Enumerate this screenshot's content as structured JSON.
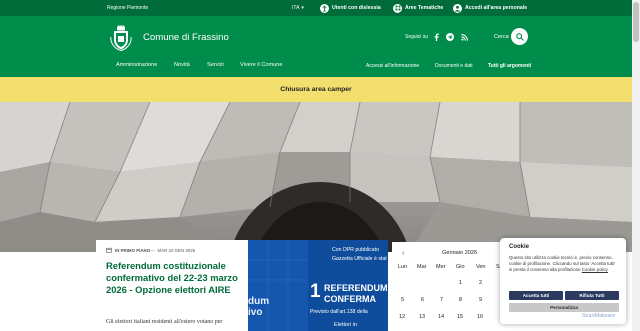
{
  "topbar": {
    "region": "Regione Piemonte",
    "lang": "ITA",
    "items": [
      {
        "label": "Utenti con dislessia",
        "icon": "accessibility-icon"
      },
      {
        "label": "Aree Tematiche",
        "icon": "grid-icon"
      },
      {
        "label": "Accedi all'area personale",
        "icon": "user-icon"
      }
    ]
  },
  "header": {
    "title": "Comune di Frassino",
    "social_label": "Seguici su",
    "social": [
      "facebook-icon",
      "telegram-icon",
      "rss-icon"
    ],
    "search_label": "Cerca",
    "colors": {
      "dark_green": "#006c3a",
      "green": "#008c4a",
      "yellow": "#f2df6e"
    }
  },
  "nav": {
    "main": [
      "Amministrazione",
      "Novità",
      "Servizi",
      "Vivere il Comune"
    ],
    "secondary": [
      "Accessi all'informazione",
      "Documenti e dati",
      "Tutti gli argomenti"
    ]
  },
  "alert": {
    "text": "Chiusura area camper"
  },
  "news": {
    "category": "IN PRIMO PIANO",
    "date": "MAR 20 GEN 2026",
    "title": "Referendum costituzionale confermativo del 22-23 marzo 2026 - Opzione elettori AIRE",
    "excerpt": "Gli elettori italiani residenti all'estero votano per"
  },
  "ref_image": {
    "line1": "Con DPR pubblicato",
    "line2": "Gazzetta Ufficiale è stat",
    "big_number": "1",
    "big_line1": "REFERENDUM",
    "big_line2": "CONFERMA",
    "bottom": "Previsto dall'art.138 della",
    "left1": "dum",
    "left2": "ivo",
    "small_bottom": "Elettori in"
  },
  "calendar": {
    "month": "Gennaio 2026",
    "days_of_week": [
      "Lun",
      "Mar",
      "Mer",
      "Gio",
      "Ven",
      "Sab"
    ],
    "rows": [
      [
        "",
        "",
        "",
        "1",
        "2",
        ""
      ],
      [
        "5",
        "6",
        "7",
        "8",
        "9",
        ""
      ],
      [
        "12",
        "13",
        "14",
        "15",
        "16",
        ""
      ]
    ]
  },
  "cookie": {
    "title": "Cookie",
    "text": "Questo sito utilizza cookie tecnici e, previo consenso, cookie di profilazione. Cliccando sul tasto 'Accetta tutti' si presta il consenso alla profilazione",
    "link": "Cookie policy",
    "accept": "Accetta tutti",
    "reject": "Rifiuta Tutti",
    "customize": "Personalizza"
  },
  "watermark": "ScanMalware"
}
